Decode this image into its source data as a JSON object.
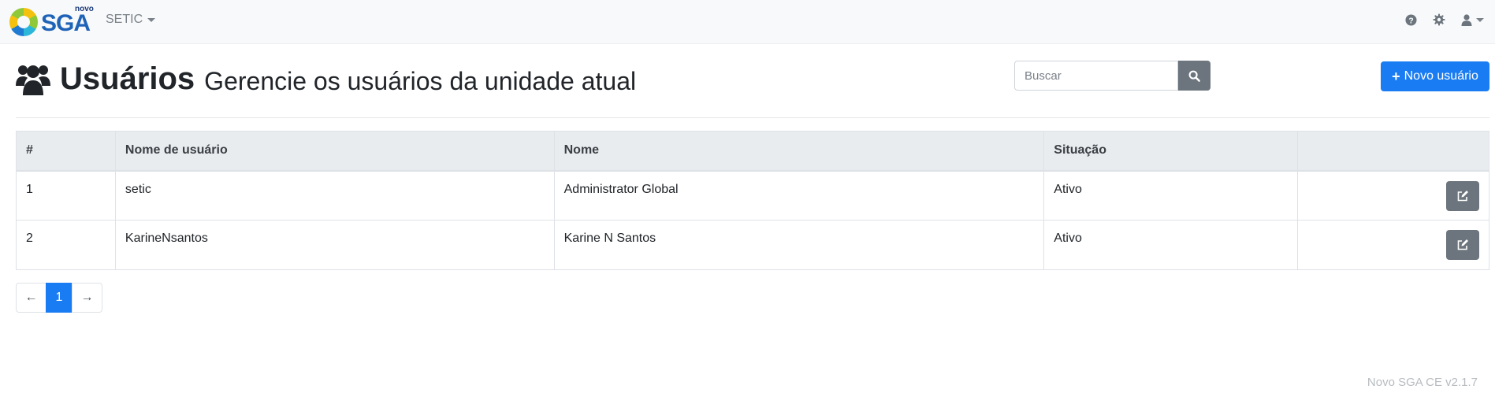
{
  "navbar": {
    "logo_small": "novo",
    "logo_text": "SGA",
    "unit_label": "SETIC",
    "icons": [
      "help-icon",
      "gear-icon",
      "user-icon"
    ]
  },
  "header": {
    "title": "Usuários",
    "subtitle": "Gerencie os usuários da unidade atual",
    "icon": "users-icon"
  },
  "search": {
    "placeholder": "Buscar",
    "value": ""
  },
  "new_user_button": {
    "label": "Novo usuário"
  },
  "table": {
    "columns": [
      "#",
      "Nome de usuário",
      "Nome",
      "Situação",
      ""
    ],
    "rows": [
      {
        "id": "1",
        "username": "setic",
        "name": "Administrator Global",
        "status": "Ativo"
      },
      {
        "id": "2",
        "username": "KarineNsantos",
        "name": "Karine N Santos",
        "status": "Ativo"
      }
    ]
  },
  "pagination": {
    "prev": "←",
    "current": "1",
    "next": "→"
  },
  "footer": {
    "version": "Novo SGA CE v2.1.7"
  },
  "colors": {
    "primary": "#1a7cf2",
    "secondary": "#6c757d",
    "success": "#3ea84d"
  }
}
